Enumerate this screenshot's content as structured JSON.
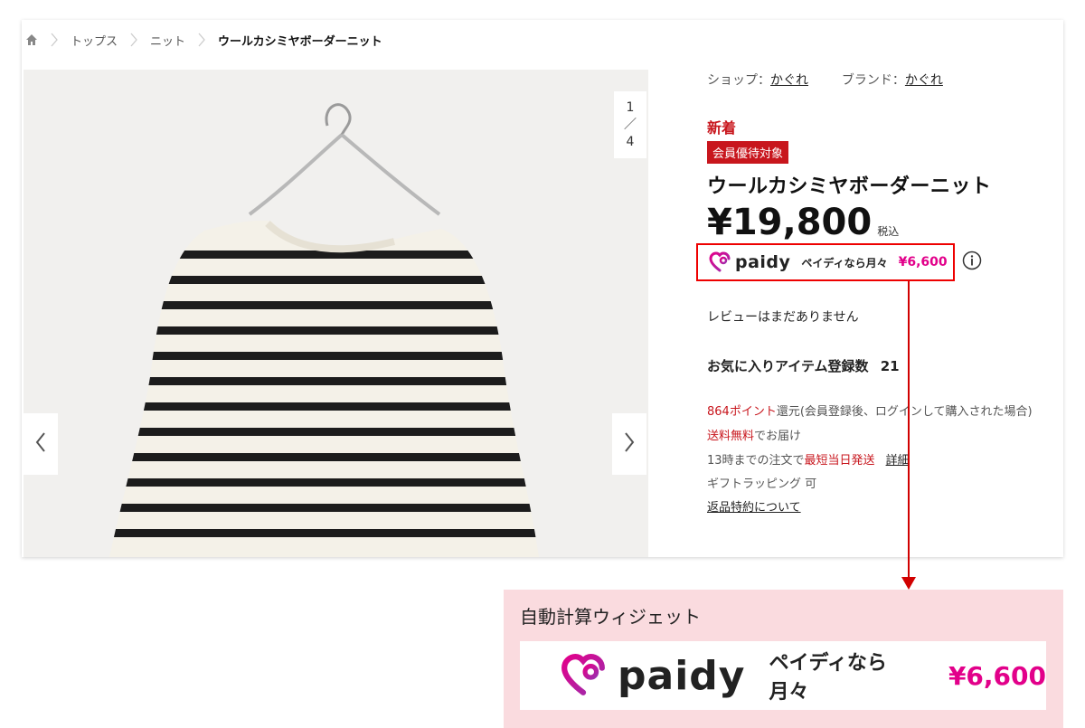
{
  "breadcrumb": {
    "items": [
      "トップス",
      "ニット"
    ],
    "current": "ウールカシミヤボーダーニット"
  },
  "gallery": {
    "counter_current": "1",
    "counter_sep": "／",
    "counter_total": "4"
  },
  "info": {
    "shop_label": "ショップ：",
    "shop_value": "かぐれ",
    "brand_label": "ブランド：",
    "brand_value": "かぐれ",
    "new_label": "新着",
    "member_badge": "会員優待対象",
    "title": "ウールカシミヤボーダーニット",
    "price": "¥19,800",
    "tax": "税込",
    "paidy_logo": "paidy",
    "paidy_text": "ペイディなら月々",
    "paidy_amount": "¥6,600",
    "review": "レビューはまだありません",
    "favorites_label": "お気に入りアイテム登録数",
    "favorites_count": "21",
    "points_value": "864ポイント",
    "points_rest": "還元(会員登録後、ログインして購入された場合)",
    "shipping_free": "送料無料",
    "shipping_rest": "でお届け",
    "sameday_prefix": "13時までの注文で",
    "sameday_red": "最短当日発送",
    "sameday_link": "詳細",
    "gift": "ギフトラッピング 可",
    "returns": "返品特約について"
  },
  "widget": {
    "title": "自動計算ウィジェット",
    "paidy_logo": "paidy",
    "paidy_text": "ペイディなら月々",
    "paidy_amount": "¥6,600"
  },
  "colors": {
    "accent_red": "#c8161d",
    "paidy_magenta": "#e2008a",
    "highlight_border": "#e00000",
    "callout_bg": "#fadbdf"
  }
}
